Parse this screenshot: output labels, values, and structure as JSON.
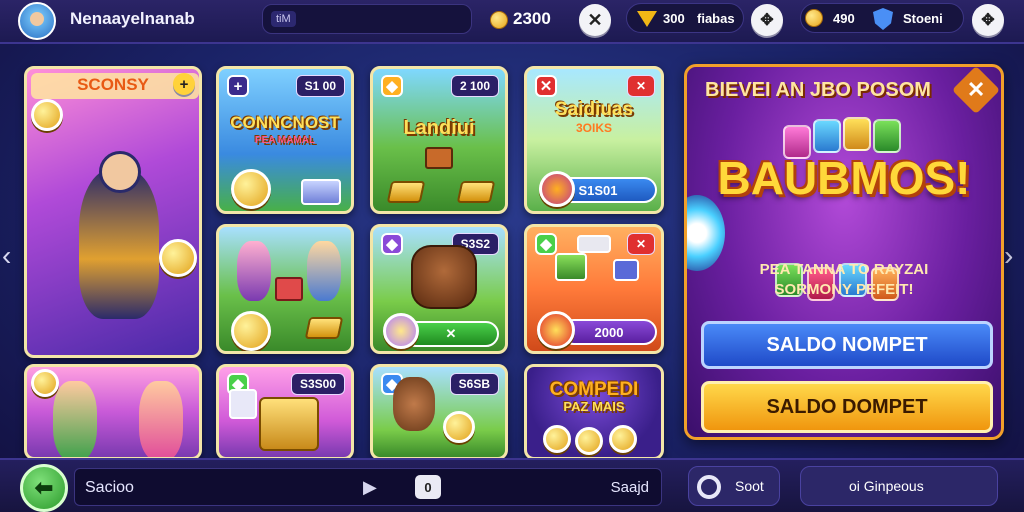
{
  "topbar": {
    "username": "Nenaayelnanab",
    "search_tag": "tiM",
    "coins": "2300",
    "stat1_value": "300",
    "stat1_label": "fiabas",
    "stat2_value": "490",
    "stat2_label": "Stoeni",
    "close_glyph": "✕"
  },
  "cards": {
    "c1": {
      "title": "SCONSY"
    },
    "c2": {
      "title": "CONNCNOST",
      "subtitle": "PEA MAMAL",
      "price": "S1 00"
    },
    "c3": {
      "title": "Landiui",
      "price": "2 100"
    },
    "c4": {
      "title": "Saidiuas",
      "subtitle": "3OIKS",
      "price": "S1S01"
    },
    "c5": {
      "price": ""
    },
    "c6": {
      "price": ""
    },
    "c7": {
      "price": "S3S2"
    },
    "c8": {
      "price": "2000"
    },
    "c9": {
      "price": "S3S00"
    },
    "c10": {
      "price": "S6SB"
    },
    "c11": {
      "title": "COMPEDI",
      "subtitle": "PAZ MAIS"
    }
  },
  "promo": {
    "header": "BIEVEI AN JBO POSOM",
    "title": "BAUBMOS!",
    "sub1": "PEA TANNA TO RAYZAI",
    "sub2": "SORMONY PEFEIT!",
    "btn_primary": "SALDO NOMPET",
    "btn_secondary": "SALDO DOMPET"
  },
  "bottombar": {
    "input_label": "Sacioo",
    "input_end": "Saajd",
    "cam_label": "0",
    "btn1_label": "Soot",
    "btn2_label": "oi Ginpeous"
  },
  "colors": {
    "accent_gold": "#ffd83a",
    "primary_blue": "#2f6fe8",
    "secondary_orange": "#f6a718"
  }
}
